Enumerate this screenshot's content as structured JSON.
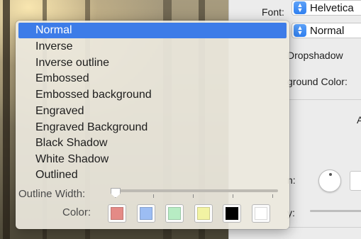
{
  "inspector": {
    "font_label": "Font:",
    "font_value": "Helvetica",
    "style_value": "Normal",
    "dropshadow_label": "Dropshadow",
    "background_color_label": "ground Color:",
    "cut_letter": "A",
    "rotation_label": "n:",
    "opacity_label": "y:"
  },
  "menu": {
    "items": [
      {
        "label": "Normal",
        "selected": true
      },
      {
        "label": "Inverse",
        "selected": false
      },
      {
        "label": "Inverse outline",
        "selected": false
      },
      {
        "label": "Embossed",
        "selected": false
      },
      {
        "label": "Embossed background",
        "selected": false
      },
      {
        "label": "Engraved",
        "selected": false
      },
      {
        "label": "Engraved Background",
        "selected": false
      },
      {
        "label": "Black Shadow",
        "selected": false
      },
      {
        "label": "White Shadow",
        "selected": false
      },
      {
        "label": "Outlined",
        "selected": false
      }
    ],
    "outline_width_label": "Outline Width:",
    "color_label": "Color:",
    "swatches": [
      "#e48a86",
      "#9cbdf3",
      "#b7ecc3",
      "#f2f3a3",
      "#000000",
      "#ffffff"
    ]
  },
  "colors": {
    "selection": "#3d7ce8",
    "popup_accent": "#2f7ff0"
  }
}
